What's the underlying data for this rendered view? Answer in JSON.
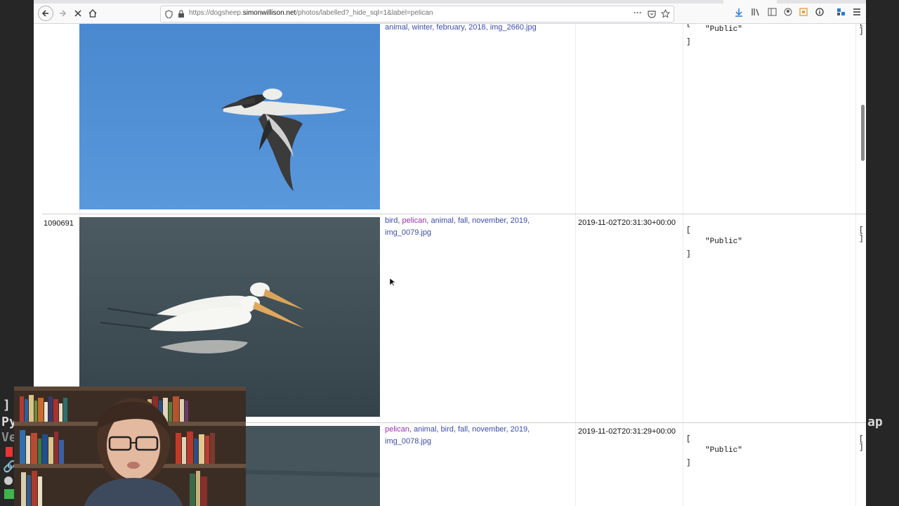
{
  "browser": {
    "url_prefix": "https://dogsheep.",
    "url_host": "simonwillison.net",
    "url_path": "/photos/labelled?_hide_sql=1&label=pelican",
    "more_label": "···"
  },
  "terminal": {
    "left_lines": [
      "]",
      "Py",
      "Ve"
    ],
    "right_text": "ap"
  },
  "rows": [
    {
      "id": "",
      "labels": [
        {
          "text": "animal",
          "highlight": false
        },
        {
          "text": "winter",
          "highlight": false
        },
        {
          "text": "february",
          "highlight": false
        },
        {
          "text": "2018",
          "highlight": false
        },
        {
          "text": "img_2660.jpg",
          "highlight": false
        }
      ],
      "date": "",
      "json_open": "[",
      "json_value": "\"Public\"",
      "json_close": "]",
      "last_col": "[ ]"
    },
    {
      "id": "1090691",
      "labels": [
        {
          "text": "bird",
          "highlight": false
        },
        {
          "text": "pelican",
          "highlight": true
        },
        {
          "text": "animal",
          "highlight": false
        },
        {
          "text": "fall",
          "highlight": false
        },
        {
          "text": "november",
          "highlight": false
        },
        {
          "text": "2019",
          "highlight": false
        },
        {
          "text": "img_0079.jpg",
          "highlight": false
        }
      ],
      "date": "2019-11-02T20:31:30+00:00",
      "json_open": "[",
      "json_value": "\"Public\"",
      "json_close": "]",
      "last_col": "[ ]"
    },
    {
      "id": "",
      "labels": [
        {
          "text": "pelican",
          "highlight": true
        },
        {
          "text": "animal",
          "highlight": false
        },
        {
          "text": "bird",
          "highlight": false
        },
        {
          "text": "fall",
          "highlight": false
        },
        {
          "text": "november",
          "highlight": false
        },
        {
          "text": "2019",
          "highlight": false
        },
        {
          "text": "img_0078.jpg",
          "highlight": false
        }
      ],
      "date": "2019-11-02T20:31:29+00:00",
      "json_open": "[",
      "json_value": "\"Public\"",
      "json_close": "]",
      "last_col": "[ ]"
    }
  ],
  "colors": {
    "link": "#3b4ca8",
    "link_highlight": "#9b2fae",
    "sky": "#4d8fd4",
    "water": "#3f4d55"
  },
  "icons": [
    "back-icon",
    "forward-icon",
    "stop-icon",
    "home-icon",
    "shield-icon",
    "lock-icon",
    "more-icon",
    "pocket-icon",
    "star-icon",
    "download-icon",
    "library-icon",
    "sidebar-icon",
    "account-icon",
    "extension-icon",
    "info-icon",
    "addons-icon",
    "menu-icon"
  ]
}
